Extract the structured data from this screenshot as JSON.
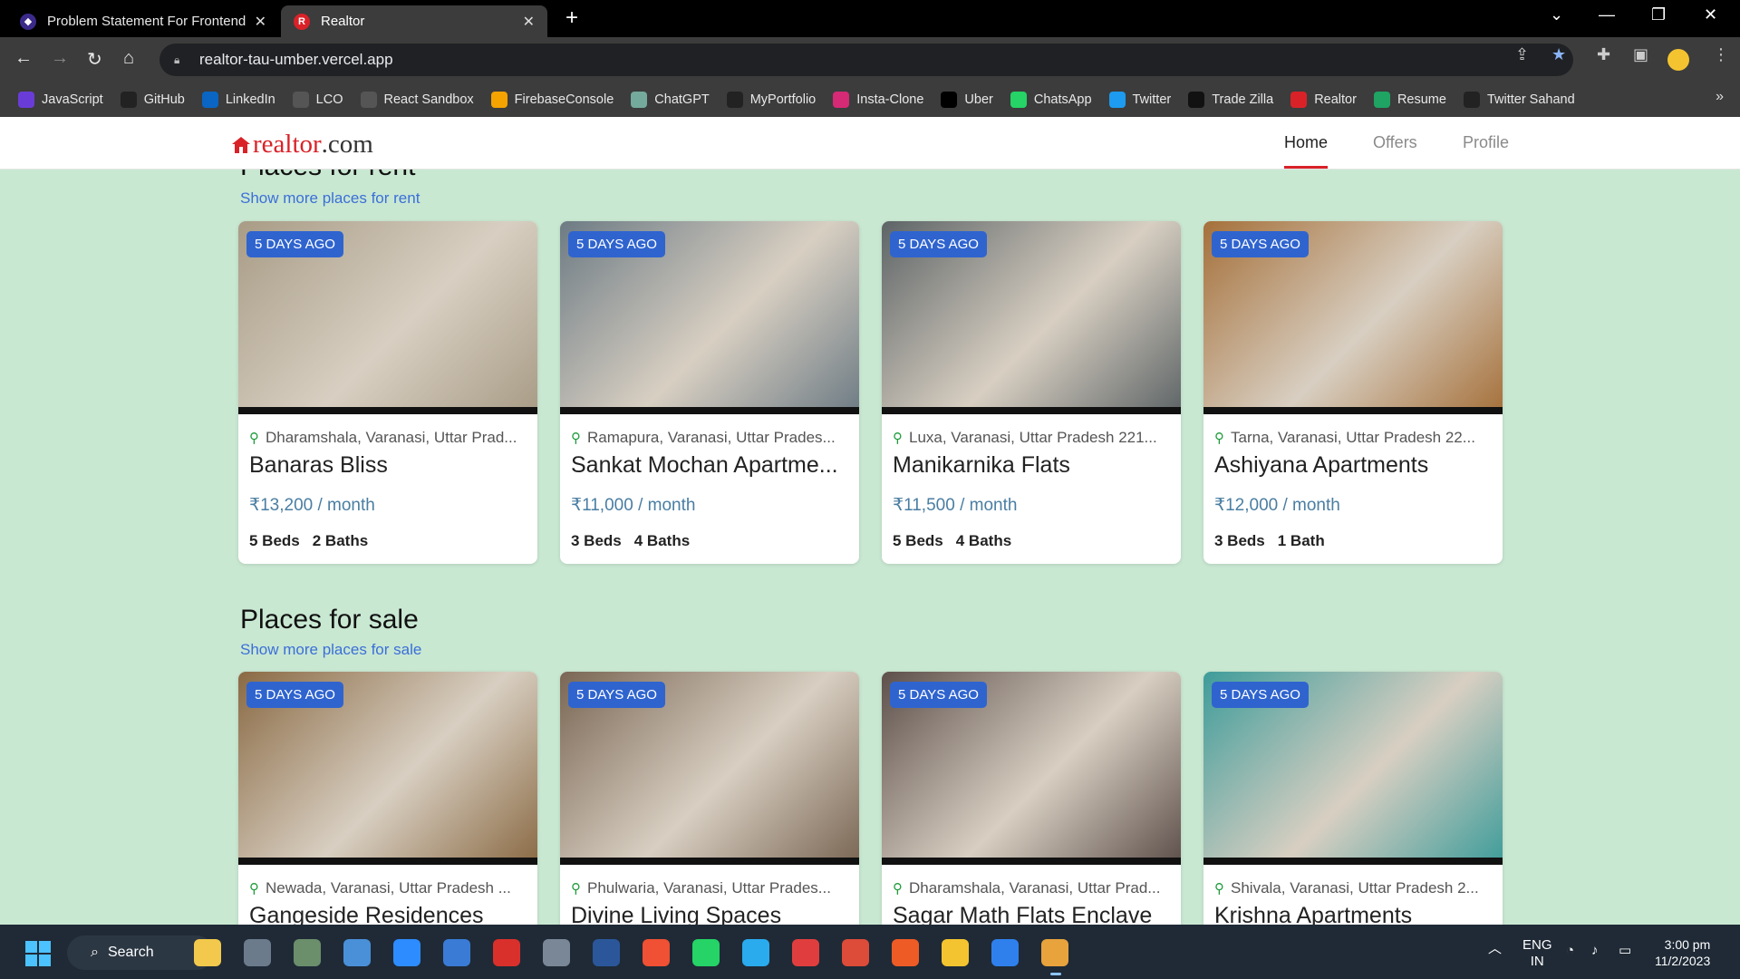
{
  "browser": {
    "tabs": [
      {
        "title": "Problem Statement For Frontend",
        "active": false,
        "icon": "frontend-favicon"
      },
      {
        "title": "Realtor",
        "active": true,
        "icon": "realtor-favicon"
      }
    ],
    "url": "realtor-tau-umber.vercel.app",
    "bookmarks": [
      {
        "label": "JavaScript",
        "icon": "javascript-icon",
        "color": "#6a3cd7"
      },
      {
        "label": "GitHub",
        "icon": "github-icon",
        "color": "#222"
      },
      {
        "label": "LinkedIn",
        "icon": "linkedin-icon",
        "color": "#0a66c2"
      },
      {
        "label": "LCO",
        "icon": "lco-icon",
        "color": "#555"
      },
      {
        "label": "React Sandbox",
        "icon": "react-sandbox-icon",
        "color": "#555"
      },
      {
        "label": "FirebaseConsole",
        "icon": "firebase-icon",
        "color": "#f4a300"
      },
      {
        "label": "ChatGPT",
        "icon": "chatgpt-icon",
        "color": "#74aa9c"
      },
      {
        "label": "MyPortfolio",
        "icon": "portfolio-icon",
        "color": "#222"
      },
      {
        "label": "Insta-Clone",
        "icon": "instagram-icon",
        "color": "#d62976"
      },
      {
        "label": "Uber",
        "icon": "uber-icon",
        "color": "#000"
      },
      {
        "label": "ChatsApp",
        "icon": "chatsapp-icon",
        "color": "#25d366"
      },
      {
        "label": "Twitter",
        "icon": "twitter-icon",
        "color": "#1d9bf0"
      },
      {
        "label": "Trade Zilla",
        "icon": "tradezilla-icon",
        "color": "#111"
      },
      {
        "label": "Realtor",
        "icon": "realtor-favicon",
        "color": "#d92228"
      },
      {
        "label": "Resume",
        "icon": "drive-icon",
        "color": "#1fa463"
      },
      {
        "label": "Twitter Sahand",
        "icon": "github-icon",
        "color": "#222"
      }
    ]
  },
  "site": {
    "logo": {
      "brand": "realtor",
      "suffix": ".com"
    },
    "nav": [
      {
        "label": "Home",
        "active": true
      },
      {
        "label": "Offers",
        "active": false
      },
      {
        "label": "Profile",
        "active": false
      }
    ]
  },
  "rent": {
    "title": "Places for rent",
    "link": "Show more places for rent",
    "listings": [
      {
        "badge": "5 DAYS AGO",
        "location": "Dharamshala, Varanasi, Uttar Prad...",
        "name": "Banaras Bliss",
        "price": "₹13,200 / month",
        "beds": "5 Beds",
        "baths": "2 Baths",
        "img_color": "#a89c86"
      },
      {
        "badge": "5 DAYS AGO",
        "location": "Ramapura, Varanasi, Uttar Prades...",
        "name": "Sankat Mochan Apartme...",
        "price": "₹11,000 / month",
        "beds": "3 Beds",
        "baths": "4 Baths",
        "img_color": "#6d7b84"
      },
      {
        "badge": "5 DAYS AGO",
        "location": "Luxa, Varanasi, Uttar Pradesh 221...",
        "name": "Manikarnika Flats",
        "price": "₹11,500 / month",
        "beds": "5 Beds",
        "baths": "4 Baths",
        "img_color": "#5d6466"
      },
      {
        "badge": "5 DAYS AGO",
        "location": "Tarna, Varanasi, Uttar Pradesh 22...",
        "name": "Ashiyana Apartments",
        "price": "₹12,000 / month",
        "beds": "3 Beds",
        "baths": "1 Bath",
        "img_color": "#a5703a"
      }
    ]
  },
  "sale": {
    "title": "Places for sale",
    "link": "Show more places for sale",
    "listings": [
      {
        "badge": "5 DAYS AGO",
        "location": "Newada, Varanasi, Uttar Pradesh ...",
        "name": "Gangeside Residences",
        "img_color": "#8a6a44"
      },
      {
        "badge": "5 DAYS AGO",
        "location": "Phulwaria, Varanasi, Uttar Prades...",
        "name": "Divine Living Spaces",
        "img_color": "#7a6654"
      },
      {
        "badge": "5 DAYS AGO",
        "location": "Dharamshala, Varanasi, Uttar Prad...",
        "name": "Sagar Math Flats Enclave",
        "img_color": "#5d4f4a"
      },
      {
        "badge": "5 DAYS AGO",
        "location": "Shivala, Varanasi, Uttar Pradesh 2...",
        "name": "Krishna Apartments",
        "img_color": "#3e9c9a"
      }
    ]
  },
  "taskbar": {
    "search_label": "Search",
    "apps": [
      "file-explorer-icon",
      "camera-icon",
      "calculator-icon",
      "photos-icon",
      "zoom-icon",
      "mail-icon",
      "acrobat-icon",
      "settings-icon",
      "word-icon",
      "git-icon",
      "whatsapp-icon",
      "telegram-icon",
      "vlc-icon",
      "chrome-icon",
      "postman-icon",
      "folder-icon",
      "vscode-icon",
      "chrome-canary-icon"
    ],
    "lang_top": "ENG",
    "lang_bottom": "IN",
    "time": "3:00 pm",
    "date": "11/2/2023"
  },
  "colors": {
    "brand_red": "#d92228",
    "badge_blue": "#2f64cf",
    "page_bg": "#c9e8d2",
    "price_blue": "#4a7ea2"
  }
}
